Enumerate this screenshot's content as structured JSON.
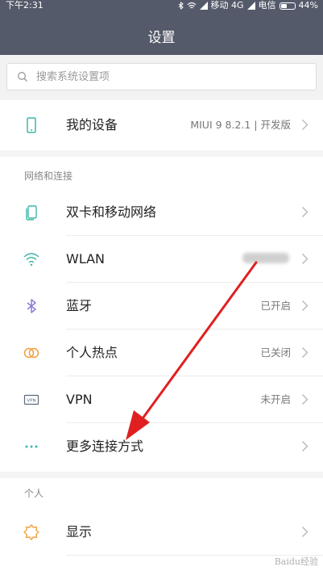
{
  "status_bar": {
    "time": "下午2:31",
    "carrier1": "移动 4G",
    "carrier2": "电信",
    "battery": "44%"
  },
  "header": {
    "title": "设置"
  },
  "search": {
    "placeholder": "搜索系统设置项"
  },
  "device": {
    "label": "我的设备",
    "value": "MIUI 9 8.2.1 | 开发版"
  },
  "network_section": {
    "title": "网络和连接",
    "items": [
      {
        "label": "双卡和移动网络",
        "value": "",
        "icon": "sim-card-icon"
      },
      {
        "label": "WLAN",
        "value": "",
        "icon": "wifi-icon"
      },
      {
        "label": "蓝牙",
        "value": "已开启",
        "icon": "bluetooth-icon"
      },
      {
        "label": "个人热点",
        "value": "已关闭",
        "icon": "hotspot-icon"
      },
      {
        "label": "VPN",
        "value": "未开启",
        "icon": "vpn-icon"
      },
      {
        "label": "更多连接方式",
        "value": "",
        "icon": "more-dots-icon"
      }
    ]
  },
  "personal_section": {
    "title": "个人",
    "items": [
      {
        "label": "显示",
        "value": "",
        "icon": "display-sun-icon"
      }
    ]
  },
  "watermark": "Baidu经验",
  "colors": {
    "header_bg": "#545a6a",
    "accent_teal": "#3fb7a4",
    "annotation_red": "#e02020"
  }
}
